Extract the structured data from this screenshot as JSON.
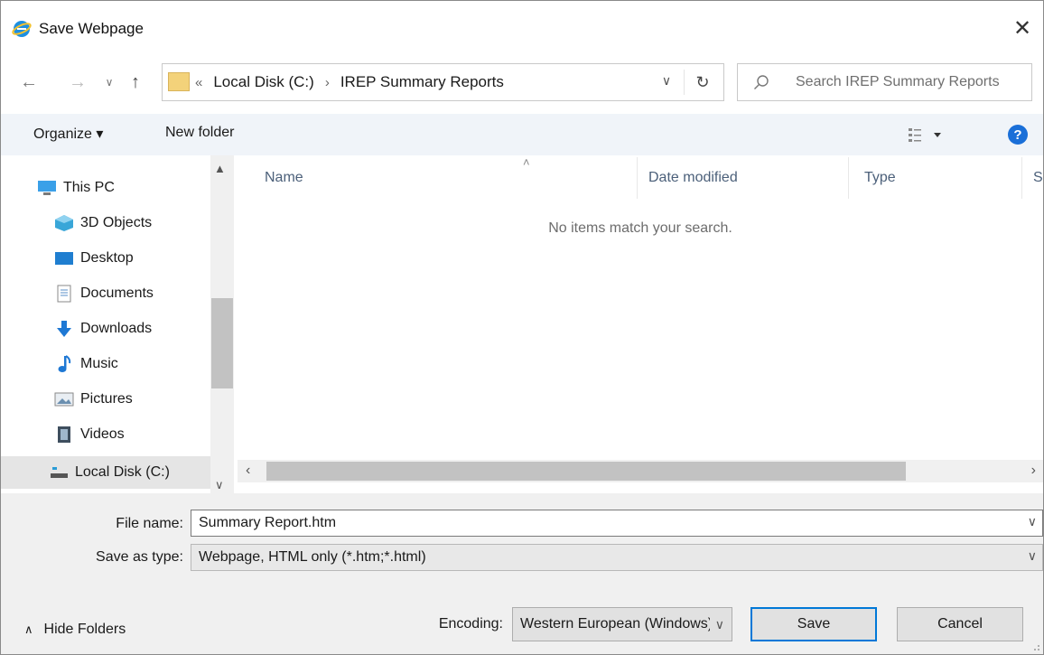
{
  "window": {
    "title": "Save Webpage",
    "close_glyph": "✕"
  },
  "nav": {
    "breadcrumb": {
      "overflow": "«",
      "items": [
        "Local Disk (C:)",
        "IREP Summary Reports"
      ],
      "separator": "›"
    },
    "search_placeholder": "Search IREP Summary Reports"
  },
  "toolbar": {
    "organize_label": "Organize ▾",
    "new_folder_label": "New folder",
    "help_glyph": "?"
  },
  "sidebar": {
    "items": [
      {
        "label": "This PC",
        "icon": "this-pc-icon"
      },
      {
        "label": "3D Objects",
        "icon": "3d-objects-icon"
      },
      {
        "label": "Desktop",
        "icon": "desktop-icon"
      },
      {
        "label": "Documents",
        "icon": "documents-icon"
      },
      {
        "label": "Downloads",
        "icon": "downloads-icon"
      },
      {
        "label": "Music",
        "icon": "music-icon"
      },
      {
        "label": "Pictures",
        "icon": "pictures-icon"
      },
      {
        "label": "Videos",
        "icon": "videos-icon"
      },
      {
        "label": "Local Disk (C:)",
        "icon": "local-disk-icon",
        "selected": true
      }
    ]
  },
  "list": {
    "columns": [
      "Name",
      "Date modified",
      "Type",
      "Si"
    ],
    "empty_message": "No items match your search."
  },
  "form": {
    "file_name_label": "File name:",
    "file_name_value": "Summary Report.htm",
    "save_type_label": "Save as type:",
    "save_type_value": "Webpage, HTML only (*.htm;*.html)",
    "encoding_label": "Encoding:",
    "encoding_value": "Western European (Windows)"
  },
  "footer": {
    "hide_folders_label": "Hide Folders",
    "save_label": "Save",
    "cancel_label": "Cancel"
  },
  "colors": {
    "accent": "#0078d7",
    "help": "#1a6fd8",
    "toolbar_bg": "#f0f4f9",
    "column_header": "#4c607a"
  }
}
